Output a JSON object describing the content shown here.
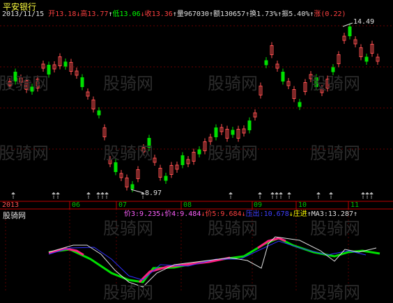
{
  "window": {
    "title": "平安银行"
  },
  "quote": {
    "date": "2013/11/15",
    "open_label": "开",
    "open": "13.18",
    "high_label": "高",
    "high": "13.77",
    "low_label": "低",
    "low": "13.06",
    "close_label": "收",
    "close": "13.36",
    "volume_label": "量",
    "volume": "967030",
    "amount_label": "额",
    "amount": "130657",
    "turnover_label": "换",
    "turnover": "1.73%",
    "amplitude_label": "振",
    "amplitude": "5.40%",
    "change_label": "涨",
    "change": "(0.22)"
  },
  "price_panel": {
    "max_marker": "14.49",
    "min_marker": "8.97"
  },
  "date_axis": [
    "2013",
    "06",
    "07",
    "08",
    "09",
    "10",
    "11"
  ],
  "indicator_panel": {
    "name": "股骑网",
    "price3_label": "价3:",
    "price3": "9.235",
    "price4_label": "价4:",
    "price4": "9.484",
    "price5_label": "价5:",
    "price5": "9.684",
    "pressure_label": "压出:",
    "pressure": "10.678",
    "enter_label": "庄进",
    "ma3_label": "MA3:",
    "ma3": "13.287"
  },
  "watermark": "股骑网",
  "colors": {
    "up": "#ff5050",
    "down": "#00e000",
    "axis": "#c00000",
    "text_white": "#ffffff",
    "pink": "#ff60ff",
    "blue": "#4040ff",
    "yellow": "#ffff00"
  }
}
